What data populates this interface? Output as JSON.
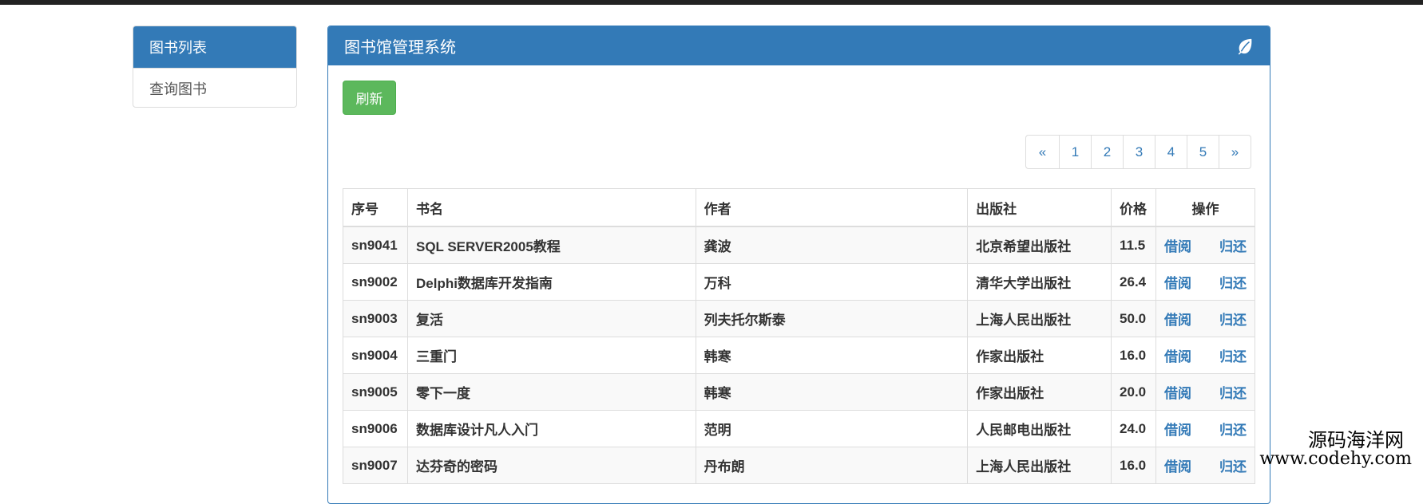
{
  "sidebar": {
    "title": "图书列表",
    "items": [
      {
        "label": "查询图书"
      }
    ]
  },
  "panel": {
    "title": "图书馆管理系统",
    "title_icon": "leaf-icon",
    "refresh_label": "刷新"
  },
  "pagination": {
    "prev": "«",
    "pages": [
      "1",
      "2",
      "3",
      "4",
      "5"
    ],
    "next": "»"
  },
  "table": {
    "headers": {
      "id": "序号",
      "name": "书名",
      "author": "作者",
      "publisher": "出版社",
      "price": "价格",
      "ops": "操作"
    },
    "borrow_label": "借阅",
    "return_label": "归还",
    "rows": [
      {
        "id": "sn9041",
        "name": "SQL SERVER2005教程",
        "author": "龚波",
        "publisher": "北京希望出版社",
        "price": "11.5"
      },
      {
        "id": "sn9002",
        "name": "Delphi数据库开发指南",
        "author": "万科",
        "publisher": "清华大学出版社",
        "price": "26.4"
      },
      {
        "id": "sn9003",
        "name": "复活",
        "author": "列夫托尔斯泰",
        "publisher": "上海人民出版社",
        "price": "50.0"
      },
      {
        "id": "sn9004",
        "name": "三重门",
        "author": "韩寒",
        "publisher": "作家出版社",
        "price": "16.0"
      },
      {
        "id": "sn9005",
        "name": "零下一度",
        "author": "韩寒",
        "publisher": "作家出版社",
        "price": "20.0"
      },
      {
        "id": "sn9006",
        "name": "数据库设计凡人入门",
        "author": "范明",
        "publisher": "人民邮电出版社",
        "price": "24.0"
      },
      {
        "id": "sn9007",
        "name": "达芬奇的密码",
        "author": "丹布朗",
        "publisher": "上海人民出版社",
        "price": "16.0"
      }
    ]
  },
  "watermark": {
    "cn": "源码海洋网",
    "url": "www.codehy.com"
  },
  "colors": {
    "primary": "#337ab7",
    "success": "#5cb85c",
    "topbar": "#222222",
    "border": "#dddddd"
  }
}
